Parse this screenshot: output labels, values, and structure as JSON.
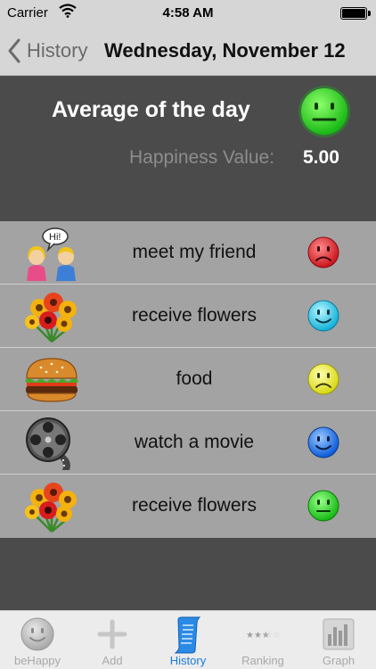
{
  "status_bar": {
    "carrier": "Carrier",
    "time": "4:58 AM"
  },
  "nav": {
    "back_label": "History",
    "title": "Wednesday, November 12"
  },
  "summary": {
    "title": "Average of the day",
    "happiness_label": "Happiness Value:",
    "happiness_value": "5.00",
    "face_color": "#22e01e"
  },
  "entries": [
    {
      "label": "meet my friend",
      "icon": "friends-icon",
      "face_color": "#e01e28",
      "mood": "sad"
    },
    {
      "label": "receive flowers",
      "icon": "flowers-icon",
      "face_color": "#2ad8f0",
      "mood": "happy"
    },
    {
      "label": "food",
      "icon": "burger-icon",
      "face_color": "#f2f21e",
      "mood": "sad"
    },
    {
      "label": "watch a movie",
      "icon": "film-reel-icon",
      "face_color": "#1e7ef2",
      "mood": "happy"
    },
    {
      "label": "receive flowers",
      "icon": "flowers-icon",
      "face_color": "#22e01e",
      "mood": "neutral"
    }
  ],
  "tabs": [
    {
      "label": "beHappy",
      "icon": "smiley-icon",
      "active": false
    },
    {
      "label": "Add",
      "icon": "plus-icon",
      "active": false
    },
    {
      "label": "History",
      "icon": "scroll-icon",
      "active": true
    },
    {
      "label": "Ranking",
      "icon": "stars-icon",
      "active": false
    },
    {
      "label": "Graph",
      "icon": "bar-graph-icon",
      "active": false
    }
  ],
  "colors": {
    "accent": "#1a7ae0",
    "panel": "#4b4b4b",
    "list": "#a3a3a3"
  }
}
